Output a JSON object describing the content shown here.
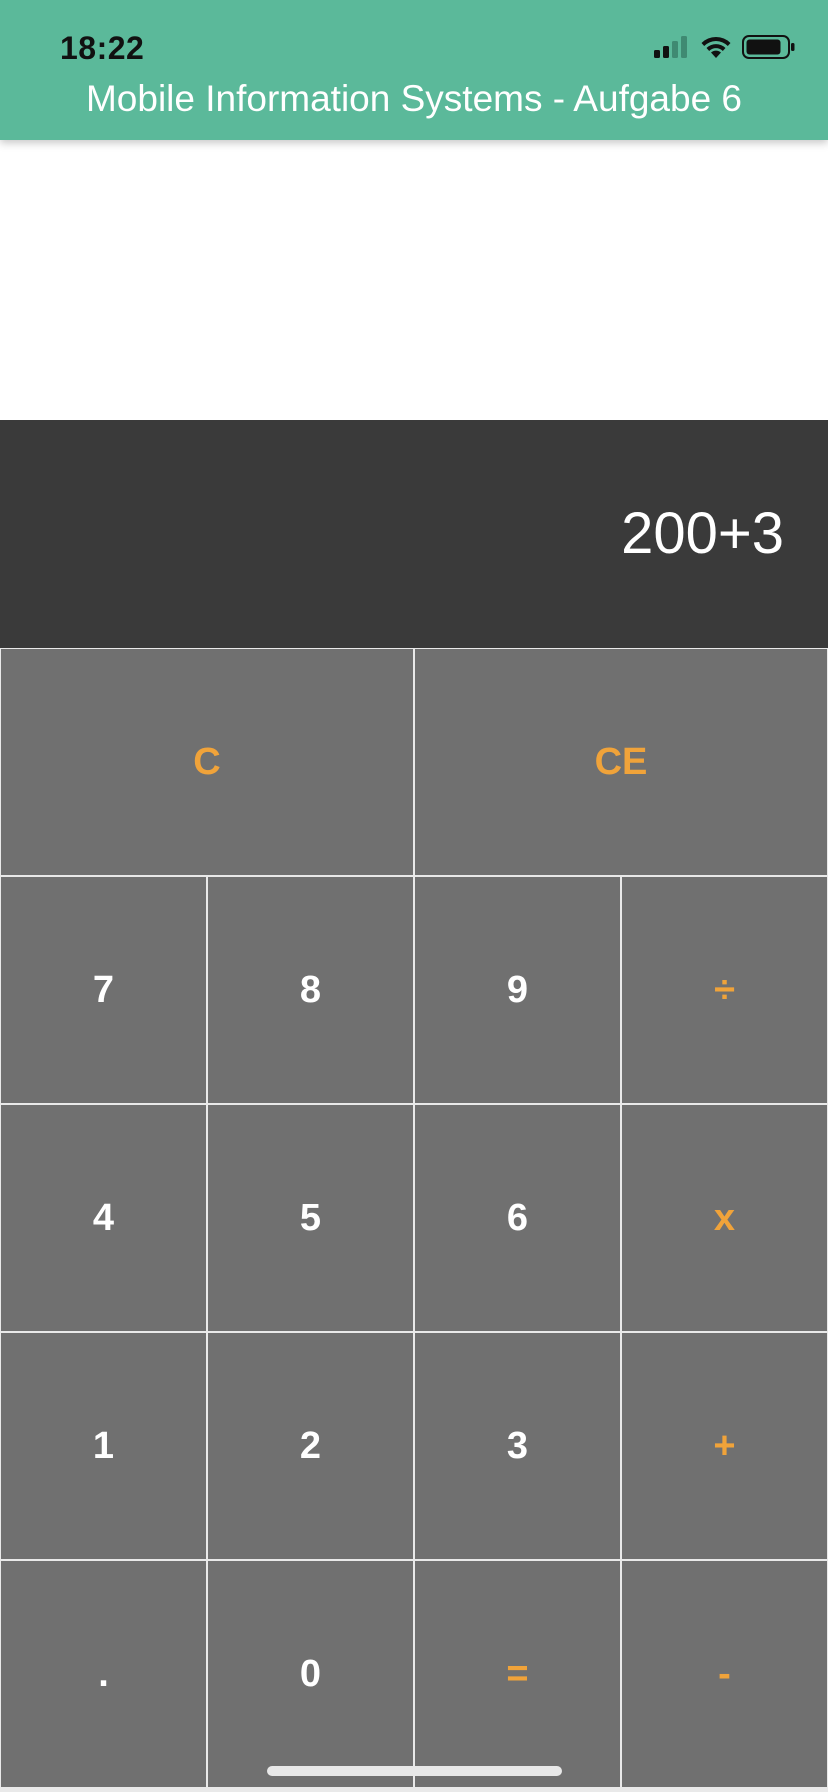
{
  "status_bar": {
    "time": "18:22",
    "icons": [
      "cellular-signal-icon",
      "wifi-icon",
      "battery-icon"
    ]
  },
  "header": {
    "title": "Mobile Information Systems - Aufgabe 6",
    "background_color": "#5bb99a"
  },
  "display": {
    "value": "200+3",
    "background_color": "#3a3a3a"
  },
  "keypad": {
    "key_color": "#707070",
    "operator_text_color": "#f0a33a",
    "digit_text_color": "#ffffff",
    "rows": [
      [
        {
          "label": "C",
          "kind": "op",
          "name": "clear-button"
        },
        {
          "label": "CE",
          "kind": "op",
          "name": "clear-entry-button"
        }
      ],
      [
        {
          "label": "7",
          "kind": "digit",
          "name": "digit-7-button"
        },
        {
          "label": "8",
          "kind": "digit",
          "name": "digit-8-button"
        },
        {
          "label": "9",
          "kind": "digit",
          "name": "digit-9-button"
        },
        {
          "label": "÷",
          "kind": "op",
          "name": "divide-button"
        }
      ],
      [
        {
          "label": "4",
          "kind": "digit",
          "name": "digit-4-button"
        },
        {
          "label": "5",
          "kind": "digit",
          "name": "digit-5-button"
        },
        {
          "label": "6",
          "kind": "digit",
          "name": "digit-6-button"
        },
        {
          "label": "x",
          "kind": "op",
          "name": "multiply-button"
        }
      ],
      [
        {
          "label": "1",
          "kind": "digit",
          "name": "digit-1-button"
        },
        {
          "label": "2",
          "kind": "digit",
          "name": "digit-2-button"
        },
        {
          "label": "3",
          "kind": "digit",
          "name": "digit-3-button"
        },
        {
          "label": "+",
          "kind": "op",
          "name": "add-button"
        }
      ],
      [
        {
          "label": ".",
          "kind": "digit",
          "name": "decimal-point-button"
        },
        {
          "label": "0",
          "kind": "digit",
          "name": "digit-0-button"
        },
        {
          "label": "=",
          "kind": "op",
          "name": "equals-button"
        },
        {
          "label": "-",
          "kind": "op",
          "name": "subtract-button"
        }
      ]
    ]
  }
}
